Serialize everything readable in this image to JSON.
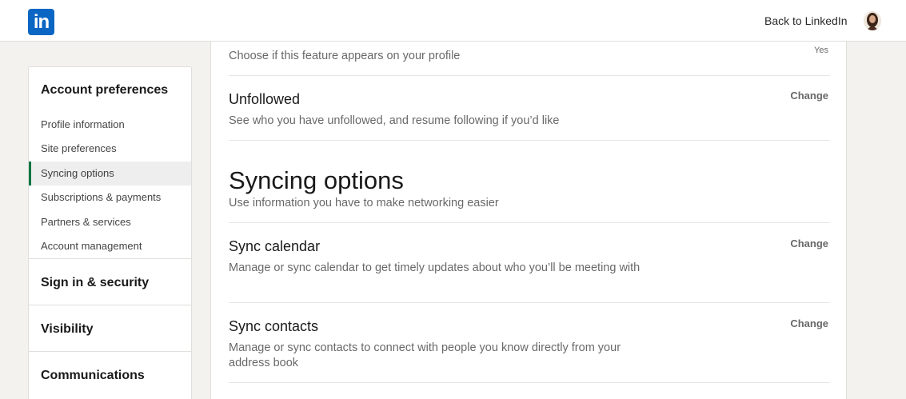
{
  "header": {
    "logo_text": "in",
    "back_link": "Back to LinkedIn",
    "brand_color": "#0a66c2"
  },
  "sidebar": {
    "account_preferences": "Account preferences",
    "items": [
      {
        "label": "Profile information"
      },
      {
        "label": "Site preferences"
      },
      {
        "label": "Syncing options",
        "active": true
      },
      {
        "label": "Subscriptions & payments"
      },
      {
        "label": "Partners & services"
      },
      {
        "label": "Account management"
      }
    ],
    "sign_in_security": "Sign in & security",
    "visibility": "Visibility",
    "communications": "Communications",
    "active_accent": "#057642"
  },
  "main": {
    "partial_setting": {
      "description": "Choose if this feature appears on your profile",
      "value": "Yes"
    },
    "unfollowed": {
      "title": "Unfollowed",
      "description": "See who you have unfollowed, and resume following if you’d like",
      "action": "Change"
    },
    "syncing_section": {
      "title": "Syncing options",
      "subtitle": "Use information you have to make networking easier"
    },
    "sync_calendar": {
      "title": "Sync calendar",
      "description": "Manage or sync calendar to get timely updates about who you’ll be meeting with",
      "action": "Change"
    },
    "sync_contacts": {
      "title": "Sync contacts",
      "description": "Manage or sync contacts to connect with people you know directly from your address book",
      "action": "Change"
    }
  }
}
